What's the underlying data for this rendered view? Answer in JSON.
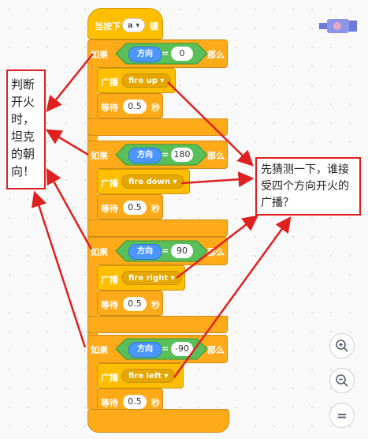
{
  "event": {
    "label": "当按下",
    "key": "a",
    "suffix": "键"
  },
  "ifs": [
    {
      "if_label": "如果",
      "var": "方向",
      "op": "=",
      "value": "0",
      "then": "那么",
      "broadcast_label": "广播",
      "message": "fire up",
      "wait_label": "等待",
      "wait_value": "0.5",
      "wait_unit": "秒"
    },
    {
      "if_label": "如果",
      "var": "方向",
      "op": "=",
      "value": "180",
      "then": "那么",
      "broadcast_label": "广播",
      "message": "fire down",
      "wait_label": "等待",
      "wait_value": "0.5",
      "wait_unit": "秒"
    },
    {
      "if_label": "如果",
      "var": "方向",
      "op": "=",
      "value": "90",
      "then": "那么",
      "broadcast_label": "广播",
      "message": "fire right",
      "wait_label": "等待",
      "wait_value": "0.5",
      "wait_unit": "秒"
    },
    {
      "if_label": "如果",
      "var": "方向",
      "op": "=",
      "value": "-90",
      "then": "那么",
      "broadcast_label": "广播",
      "message": "fire left",
      "wait_label": "等待",
      "wait_value": "0.5",
      "wait_unit": "秒"
    }
  ],
  "notes": {
    "left": "判断开火时，坦克的朝向！",
    "right": "先猜测一下，谁接受四个方向开火的广播？"
  },
  "zoom": {
    "in": "+",
    "out": "−",
    "reset": "="
  },
  "colors": {
    "control": "#ffab19",
    "control_dark": "#cf8b17",
    "events": "#ffbf00",
    "operator": "#59c059",
    "variable": "#4c97ff",
    "arrow": "#e02020"
  }
}
